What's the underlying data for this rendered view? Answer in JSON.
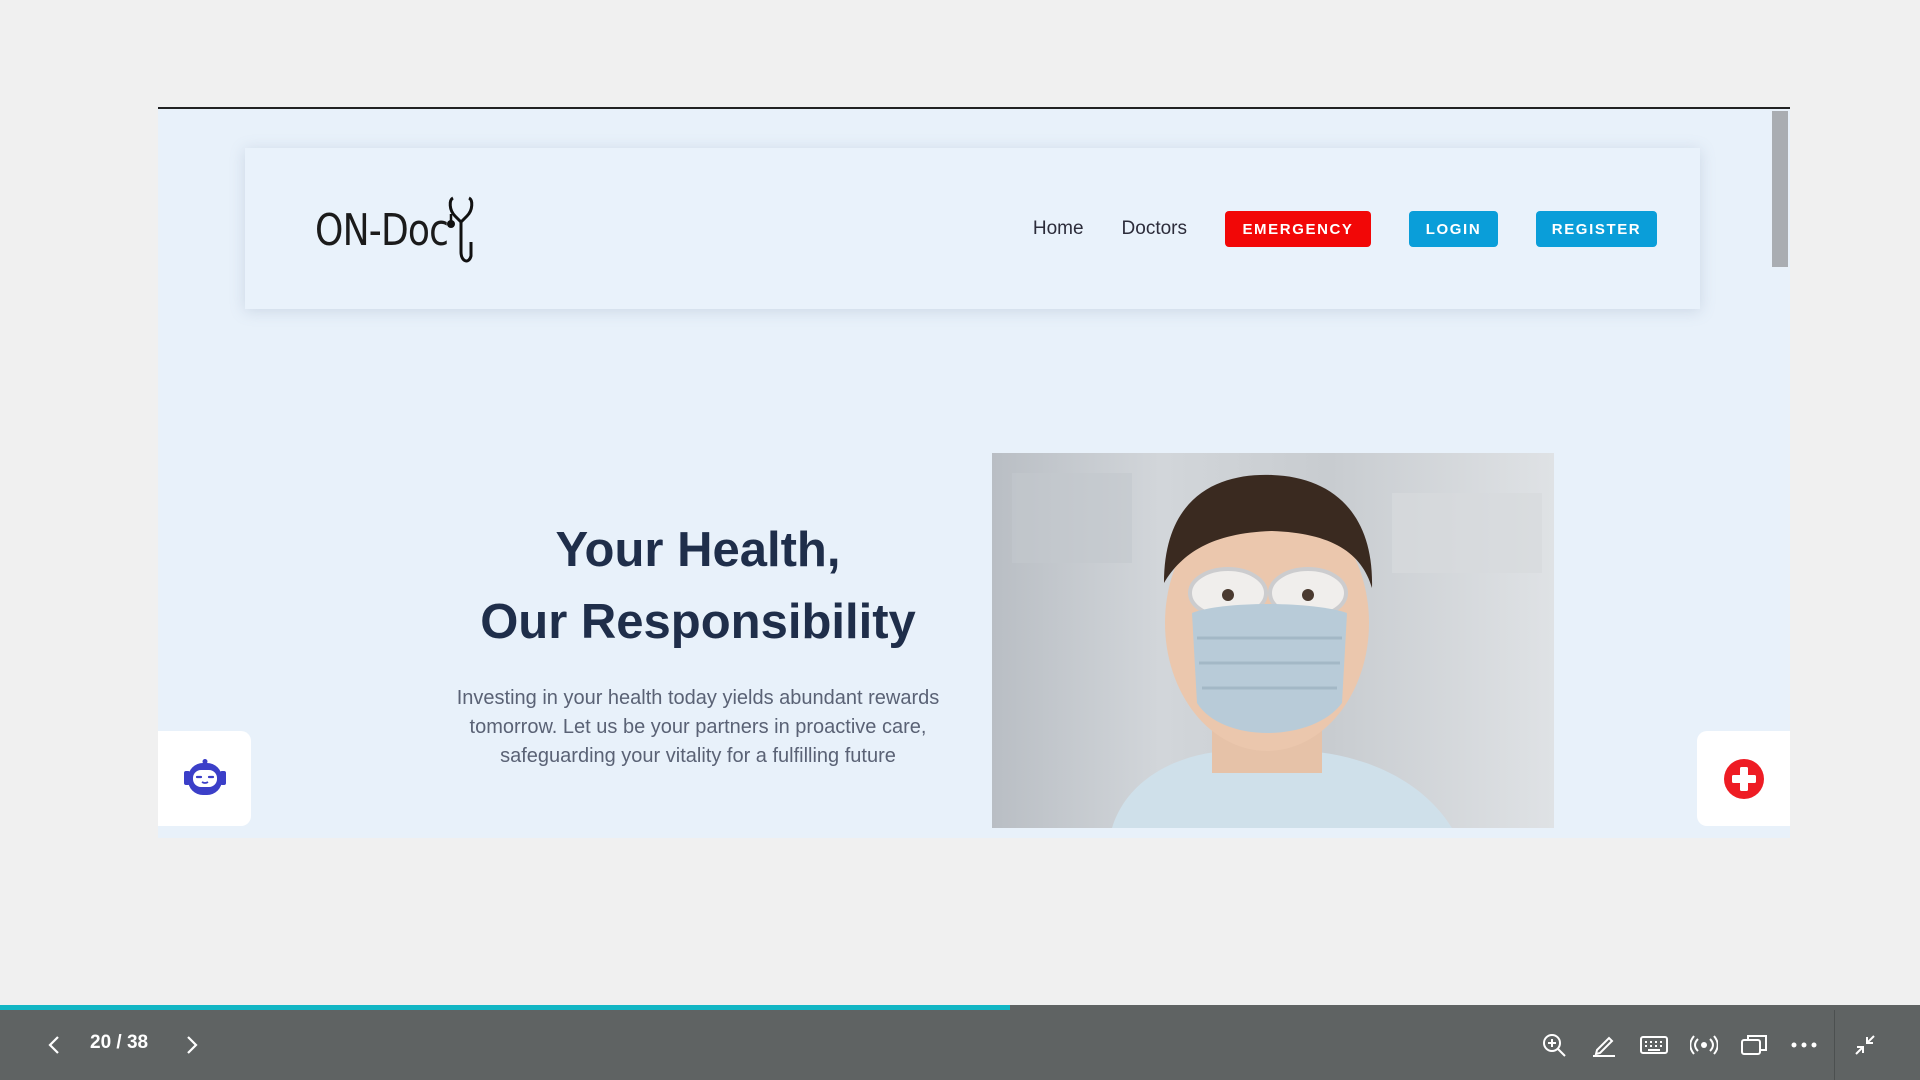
{
  "site": {
    "logo_text": "ON-Doc",
    "nav": {
      "home": "Home",
      "doctors": "Doctors",
      "emergency": "EMERGENCY",
      "login": "LOGIN",
      "register": "REGISTER"
    },
    "hero": {
      "title_line1": "Your Health,",
      "title_line2": "Our Responsibility",
      "text_line1": "Investing in your health today yields abundant rewards",
      "text_line2": "tomorrow. Let us be your partners in proactive care,",
      "text_line3": "safeguarding your vitality for a fulfilling future"
    }
  },
  "viewer": {
    "page_indicator": "20 / 38",
    "progress": 0.526
  },
  "colors": {
    "emergency": "#f20707",
    "primary_button": "#0a9ed9",
    "progress": "#12b6c4",
    "heading": "#1f2e4a"
  },
  "icons": {
    "logo": "stethoscope-icon",
    "chatbot": "robot-icon",
    "first_aid": "medical-cross-icon",
    "prev": "chevron-left-icon",
    "next": "chevron-right-icon",
    "zoom": "zoom-in-icon",
    "pen": "pen-icon",
    "keyboard": "keyboard-icon",
    "broadcast": "broadcast-icon",
    "window": "window-icon",
    "more": "more-icon",
    "exit_fullscreen": "exit-fullscreen-icon"
  }
}
